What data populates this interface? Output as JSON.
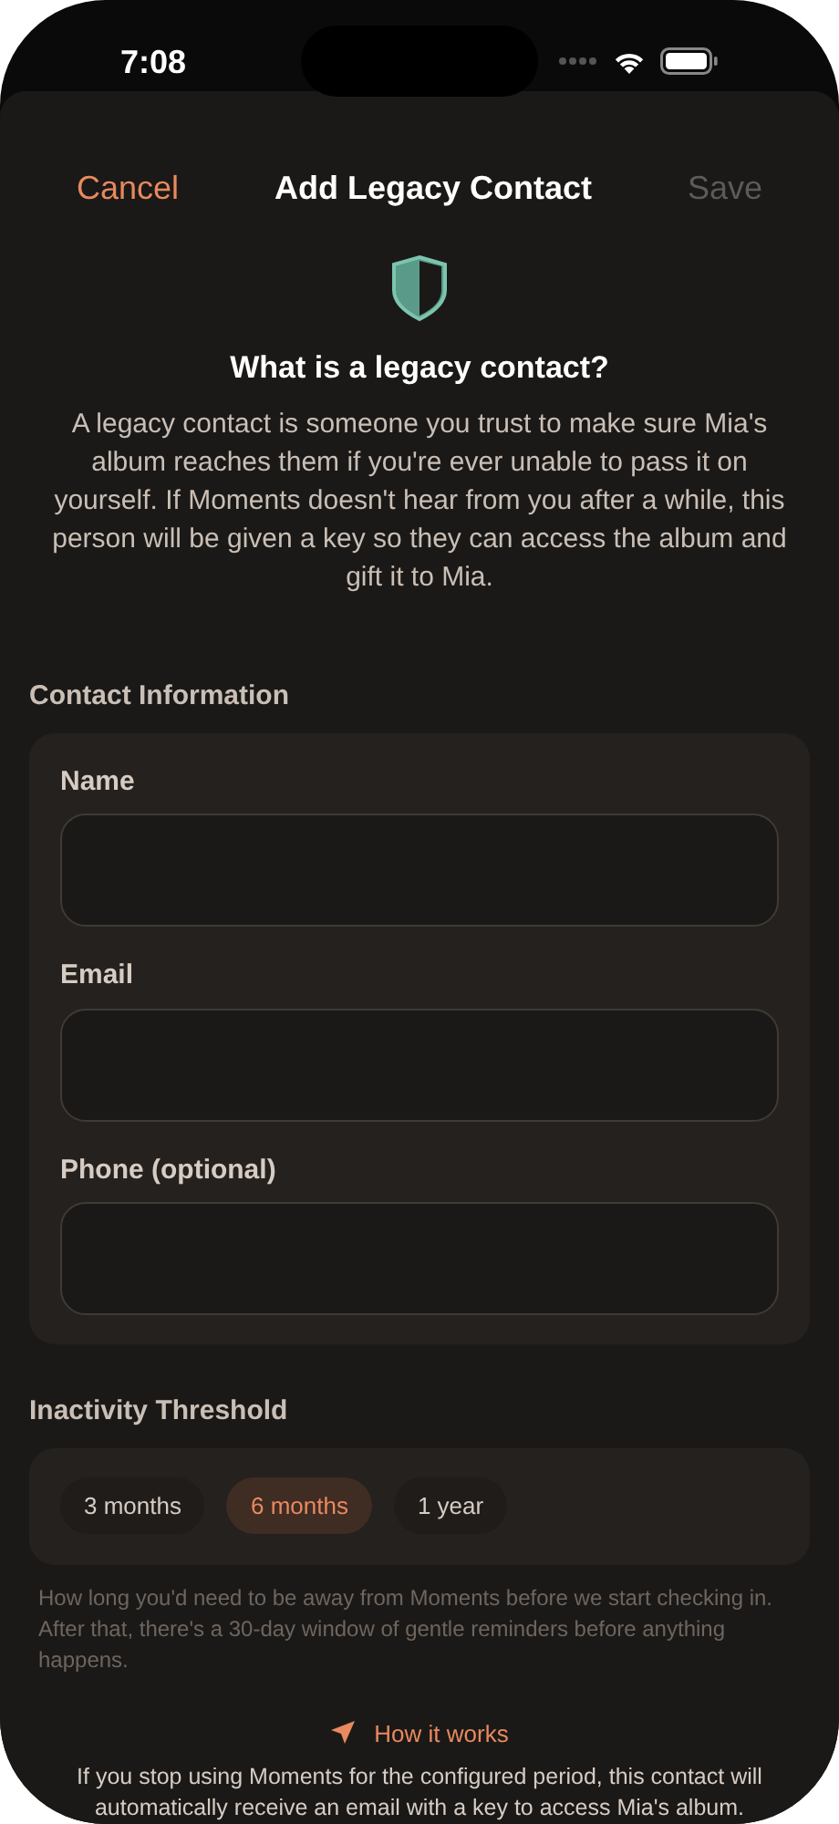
{
  "status_bar": {
    "time": "7:08"
  },
  "nav": {
    "cancel": "Cancel",
    "title": "Add Legacy Contact",
    "save": "Save",
    "save_disabled": true
  },
  "intro": {
    "title": "What is a legacy contact?",
    "body": "A legacy contact is someone you trust to make sure Mia's album reaches them if you're ever unable to pass it on yourself. If Moments doesn't hear from you after a while, this person will be given a key so they can access the album and gift it to Mia."
  },
  "contact_section": {
    "title": "Contact Information",
    "fields": [
      {
        "label": "Name"
      },
      {
        "label": "Email"
      },
      {
        "label": "Phone (optional)"
      }
    ]
  },
  "threshold_section": {
    "title": "Inactivity Threshold",
    "options": [
      {
        "label": "3 months",
        "selected": false
      },
      {
        "label": "6 months",
        "selected": true
      },
      {
        "label": "1 year",
        "selected": false
      }
    ],
    "help": "How long you'd need to be away from Moments before we start checking in. After that, there's a 30-day window of gentle reminders before anything happens."
  },
  "how_it_works": {
    "link": "How it works",
    "text": "If you stop using Moments for the configured period, this contact will automatically receive an email with a key to access Mia's album."
  }
}
